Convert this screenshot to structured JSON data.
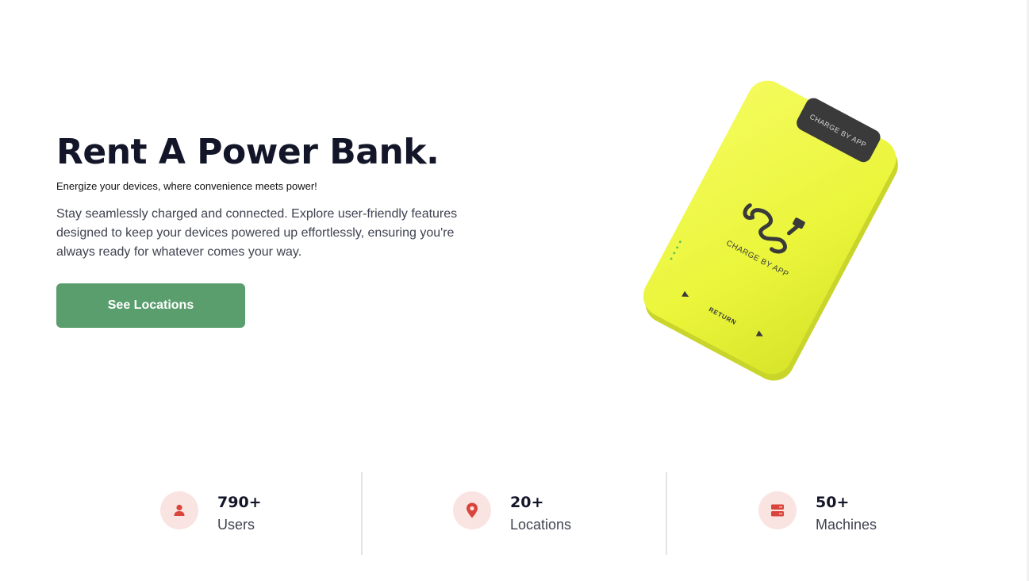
{
  "hero": {
    "title": "Rent A Power Bank.",
    "subtitle": "Energize your devices, where convenience meets power!",
    "description": "Stay seamlessly charged and connected. Explore user-friendly features designed to keep your devices powered up effortlessly, ensuring you're always ready for whatever comes your way.",
    "cta_label": "See Locations",
    "cta_color": "#5a9e6e"
  },
  "product": {
    "top_label": "CHARGE BY APP",
    "center_label": "CHARGE BY APP",
    "return_label": "RETURN",
    "body_color": "#eef73a",
    "accent_color": "#3a3a3a"
  },
  "stats": [
    {
      "icon": "user-icon",
      "value": "790+",
      "label": "Users"
    },
    {
      "icon": "location-pin-icon",
      "value": "20+",
      "label": "Locations"
    },
    {
      "icon": "server-icon",
      "value": "50+",
      "label": "Machines"
    }
  ],
  "colors": {
    "icon_bg": "#f9e4e2",
    "icon_fg": "#d9453a"
  }
}
